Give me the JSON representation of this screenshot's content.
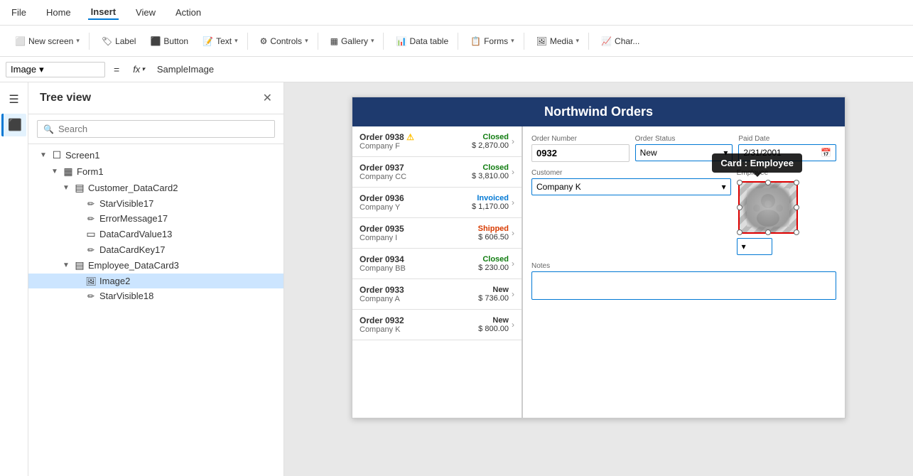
{
  "menu": {
    "items": [
      "File",
      "Home",
      "Insert",
      "View",
      "Action"
    ],
    "active": "Insert"
  },
  "toolbar": {
    "new_screen": "New screen",
    "label": "Label",
    "button": "Button",
    "text": "Text",
    "controls": "Controls",
    "gallery": "Gallery",
    "data_table": "Data table",
    "forms": "Forms",
    "media": "Media",
    "chart": "Char..."
  },
  "formula_bar": {
    "selector_value": "Image",
    "eq_sign": "=",
    "fx_label": "fx",
    "formula_value": "SampleImage"
  },
  "tree_panel": {
    "title": "Tree view",
    "search_placeholder": "Search",
    "nodes": [
      {
        "label": "Screen1",
        "indent": 1,
        "type": "screen",
        "expand": true,
        "icon": "☐"
      },
      {
        "label": "Form1",
        "indent": 2,
        "type": "form",
        "expand": true,
        "icon": "▦"
      },
      {
        "label": "Customer_DataCard2",
        "indent": 3,
        "type": "card",
        "expand": true,
        "icon": "▤"
      },
      {
        "label": "StarVisible17",
        "indent": 4,
        "type": "edit",
        "icon": "✏"
      },
      {
        "label": "ErrorMessage17",
        "indent": 4,
        "type": "edit",
        "icon": "✏"
      },
      {
        "label": "DataCardValue13",
        "indent": 4,
        "type": "input",
        "icon": "▭"
      },
      {
        "label": "DataCardKey17",
        "indent": 4,
        "type": "edit",
        "icon": "✏"
      },
      {
        "label": "Employee_DataCard3",
        "indent": 3,
        "type": "card",
        "expand": true,
        "icon": "▤"
      },
      {
        "label": "Image2",
        "indent": 4,
        "type": "image",
        "icon": "🖼",
        "selected": true
      },
      {
        "label": "StarVisible18",
        "indent": 4,
        "type": "edit",
        "icon": "✏"
      }
    ]
  },
  "app": {
    "title": "Northwind Orders",
    "orders": [
      {
        "id": "Order 0938",
        "company": "Company F",
        "status": "Closed",
        "amount": "$ 2,870.00",
        "warning": true
      },
      {
        "id": "Order 0937",
        "company": "Company CC",
        "status": "Closed",
        "amount": "$ 3,810.00"
      },
      {
        "id": "Order 0936",
        "company": "Company Y",
        "status": "Invoiced",
        "amount": "$ 1,170.00"
      },
      {
        "id": "Order 0935",
        "company": "Company I",
        "status": "Shipped",
        "amount": "$ 606.50"
      },
      {
        "id": "Order 0934",
        "company": "Company BB",
        "status": "Closed",
        "amount": "$ 230.00"
      },
      {
        "id": "Order 0933",
        "company": "Company A",
        "status": "New",
        "amount": "$ 736.00"
      },
      {
        "id": "Order 0932",
        "company": "Company K",
        "status": "New",
        "amount": "$ 800.00"
      }
    ],
    "detail": {
      "order_number_label": "Order Number",
      "order_number_value": "0932",
      "order_status_label": "Order Status",
      "order_status_value": "New",
      "paid_date_label": "Paid Date",
      "paid_date_value": "2/31/2001",
      "customer_label": "Customer",
      "customer_value": "Company K",
      "employee_label": "Employee",
      "notes_label": "Notes"
    },
    "tooltip": "Card : Employee"
  }
}
